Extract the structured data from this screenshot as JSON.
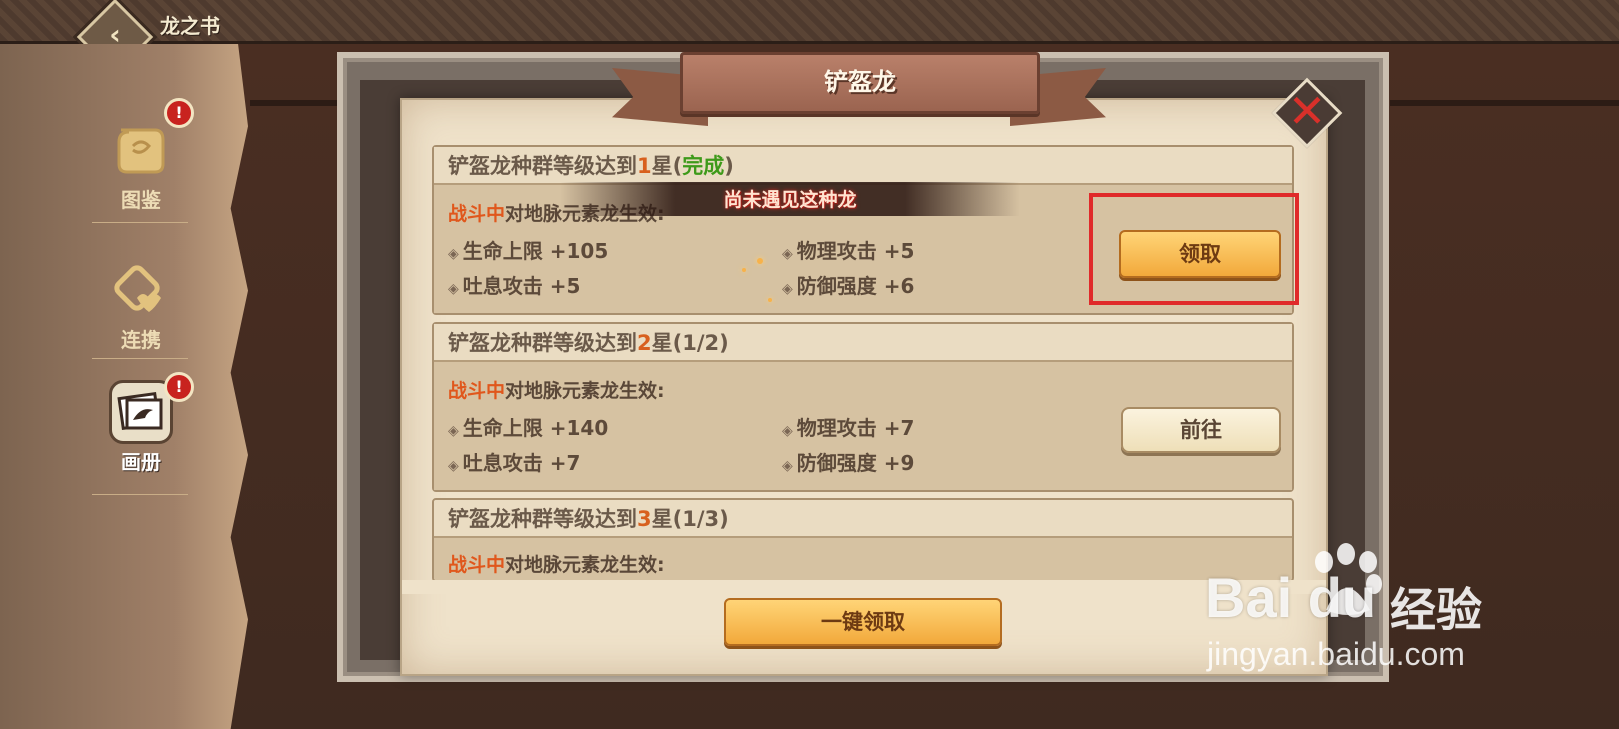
{
  "top_bar": {
    "title": "龙之书"
  },
  "sidebar": {
    "items": [
      {
        "label": "图鉴",
        "icon": "scroll-icon",
        "badge": "!"
      },
      {
        "label": "连携",
        "icon": "link-heart-icon"
      },
      {
        "label": "画册",
        "icon": "album-icon",
        "badge": "!",
        "active": true
      }
    ]
  },
  "dialog": {
    "title": "铲盔龙",
    "toast": "尚未遇见这种龙",
    "tasks": [
      {
        "title_prefix": "铲盔龙种群等级达到",
        "star_num": "1",
        "title_suffix": "星(",
        "progress": "完成",
        "title_end": ")",
        "effect_highlight": "战斗中",
        "effect_text": "对地脉元素龙生效:",
        "stats": [
          "生命上限 +105",
          "物理攻击 +5",
          "吐息攻击 +5",
          "防御强度 +6"
        ],
        "button": "领取"
      },
      {
        "title_prefix": "铲盔龙种群等级达到",
        "star_num": "2",
        "title_suffix": "星(",
        "progress": "1/2",
        "title_end": ")",
        "effect_highlight": "战斗中",
        "effect_text": "对地脉元素龙生效:",
        "stats": [
          "生命上限 +140",
          "物理攻击 +7",
          "吐息攻击 +7",
          "防御强度 +9"
        ],
        "button": "前往"
      },
      {
        "title_prefix": "铲盔龙种群等级达到",
        "star_num": "3",
        "title_suffix": "星(",
        "progress": "1/3",
        "title_end": ")",
        "effect_highlight": "战斗中",
        "effect_text": "对地脉元素龙生效:"
      }
    ],
    "claim_all": "一键领取"
  },
  "watermark": {
    "brand": "Bai du",
    "cn": "经验",
    "url": "jingyan.baidu.com"
  },
  "colors": {
    "accent_orange": "#d8601e",
    "complete_green": "#3e9a1a",
    "highlight_red": "#e02a2a",
    "parchment": "#efe2ca",
    "button_gold": "#f2a93b"
  }
}
